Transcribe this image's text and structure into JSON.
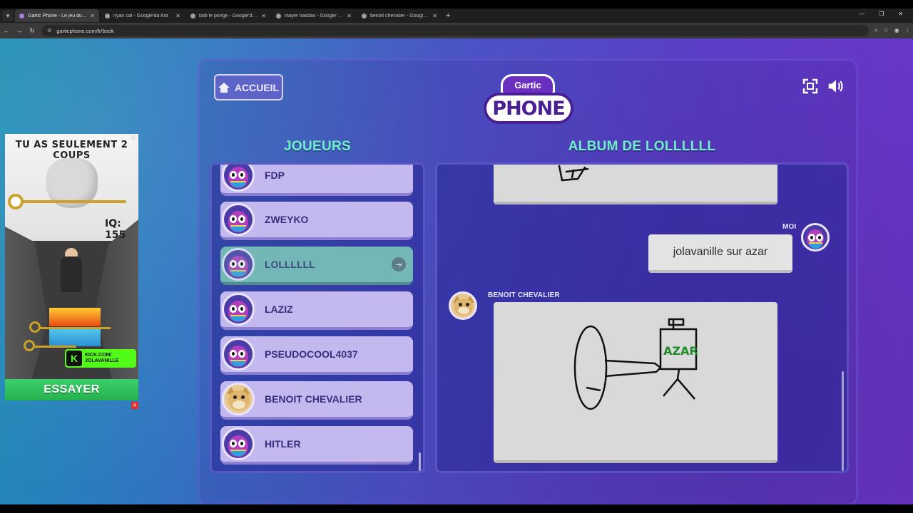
{
  "browser": {
    "tabs": [
      {
        "label": "Gartic Phone - Le jeu du téléph",
        "active": true
      },
      {
        "label": "nyan cat - Google'da Ara",
        "active": false
      },
      {
        "label": "bob le ponge - Google'da Ara",
        "active": false
      },
      {
        "label": "mayel nasdas - Google'da Ara",
        "active": false
      },
      {
        "label": "benoit chevalier - Google'da Ar",
        "active": false
      }
    ],
    "url": "garticphone.com/fr/book"
  },
  "ad": {
    "title": "TU AS SEULEMENT 2 COUPS",
    "iq_text": "IQ: 155",
    "kick_line1": "KICK.COM/",
    "kick_line2": "JOLAVANILLE",
    "cta": "ESSAYER"
  },
  "game": {
    "home_label": "ACCUEIL",
    "logo_top": "Gartic",
    "logo_main": "PHONE",
    "players_heading": "JOUEURS",
    "album_heading": "ALBUM DE LOLLLLLL",
    "icons": [
      "fullscreen-icon",
      "speaker-icon"
    ]
  },
  "players": [
    {
      "name": "FDP",
      "avatar": "purple-bird"
    },
    {
      "name": "ZWEYKO",
      "avatar": "purple-bird"
    },
    {
      "name": "LOLLLLLL",
      "avatar": "purple-bird",
      "current": true
    },
    {
      "name": "LAZIZ",
      "avatar": "purple-bird"
    },
    {
      "name": "PSEUDOCOOL4037",
      "avatar": "purple-bird"
    },
    {
      "name": "BENOIT CHEVALIER",
      "avatar": "cat"
    },
    {
      "name": "HITLER",
      "avatar": "purple-bird"
    }
  ],
  "album": {
    "my_label": "MOI",
    "my_text": "jolavanille sur azar",
    "drawing_author": "BENOIT CHEVALIER",
    "drawing_text": "AZAR"
  },
  "colors": {
    "heading": "#6ef0c8",
    "player_card": "#c4b9ee",
    "player_current": "#73b8b7"
  }
}
